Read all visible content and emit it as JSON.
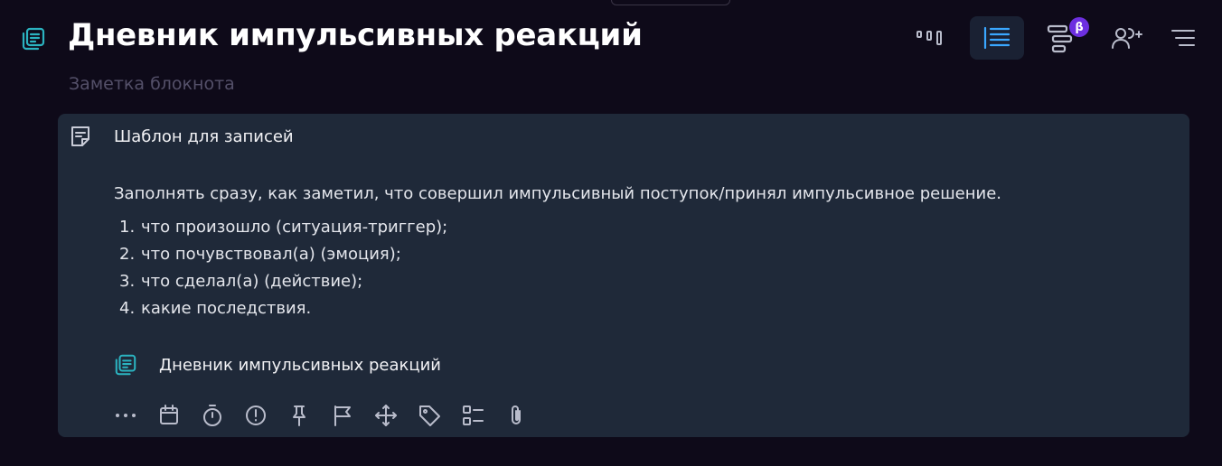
{
  "header": {
    "title": "Дневник импульсивных реакций",
    "subtitle": "Заметка блокнота",
    "icon": "notebook-icon"
  },
  "toolbar": {
    "buttons": [
      {
        "name": "board-view-button",
        "icon": "kanban-icon",
        "active": false
      },
      {
        "name": "list-view-button",
        "icon": "list-icon",
        "active": true
      },
      {
        "name": "gantt-view-button",
        "icon": "gantt-icon",
        "active": false,
        "badge": "β"
      },
      {
        "name": "add-member-button",
        "icon": "add-user-icon",
        "active": false
      },
      {
        "name": "sort-button",
        "icon": "sort-icon",
        "active": false
      }
    ],
    "badge_text": "β"
  },
  "card": {
    "icon": "note-icon",
    "title": "Шаблон для записей",
    "intro": "Заполнять сразу, как заметил, что совершил импульсивный поступок/принял импульсивное решение.",
    "list": [
      {
        "num": "1.",
        "text": "что произошло (ситуация-триггер);"
      },
      {
        "num": "2.",
        "text": "что почувствовал(а) (эмоция);"
      },
      {
        "num": "3.",
        "text": "что сделал(а) (действие);"
      },
      {
        "num": "4.",
        "text": "какие последствия."
      }
    ],
    "notebook_link": "Дневник импульсивных реакций",
    "actions": [
      "more-icon",
      "calendar-icon",
      "timer-icon",
      "priority-icon",
      "pin-icon",
      "flag-icon",
      "move-icon",
      "tag-icon",
      "checklist-icon",
      "attachment-icon"
    ]
  },
  "colors": {
    "background": "#0e0a19",
    "card": "#1f2939",
    "accent_teal": "#2bb3c0",
    "active_blue": "#3aa7ff",
    "badge_purple": "#6d2fe0",
    "muted": "#545069"
  }
}
